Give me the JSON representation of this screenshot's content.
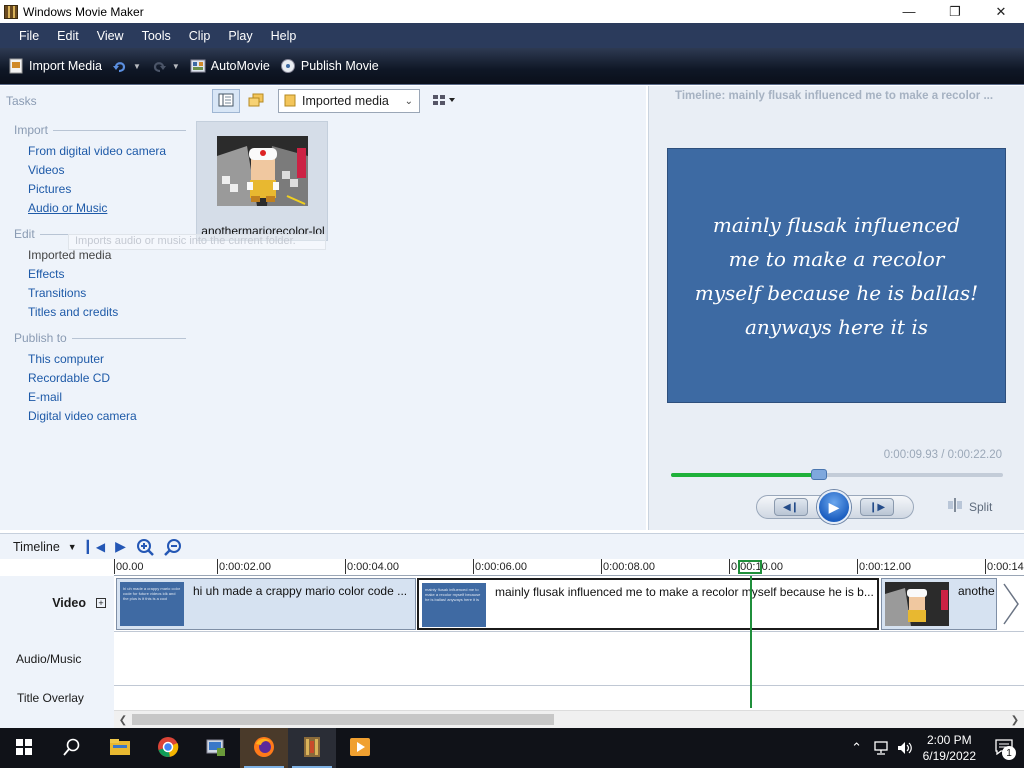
{
  "window": {
    "title": "Windows Movie Maker",
    "controls": [
      "minimize-icon",
      "maximize-icon",
      "close-icon"
    ]
  },
  "menu": [
    "File",
    "Edit",
    "View",
    "Tools",
    "Clip",
    "Play",
    "Help"
  ],
  "toolbar": {
    "import_media": "Import Media",
    "automovie": "AutoMovie",
    "publish_movie": "Publish Movie"
  },
  "tasks": {
    "title": "Tasks",
    "groups": [
      {
        "heading": "Import",
        "items": [
          "From digital video camera",
          "Videos",
          "Pictures",
          "Audio or Music"
        ]
      },
      {
        "heading": "Edit",
        "items": [
          "Imported media",
          "Effects",
          "Transitions",
          "Titles and credits"
        ]
      },
      {
        "heading": "Publish to",
        "items": [
          "This computer",
          "Recordable CD",
          "E-mail",
          "Digital video camera"
        ]
      }
    ]
  },
  "collection": {
    "dropdown": "Imported media",
    "items": [
      {
        "label": "anothermariorecolor-lol"
      }
    ],
    "tooltip": "Imports audio or music into the current folder."
  },
  "preview": {
    "title": "Timeline: mainly flusak influenced me to make a recolor ...",
    "caption_lines": [
      "mainly flusak influenced",
      "me to make a recolor",
      "myself because he is ballas!",
      "anyways here it is"
    ],
    "time": "0:00:09.93 / 0:00:22.20",
    "progress": 0.447,
    "split": "Split"
  },
  "timeline": {
    "label": "Timeline",
    "ruler": [
      "00.00",
      "0:00:02.00",
      "0:00:04.00",
      "0:00:06.00",
      "0:00:08.00",
      "0:00:10.00",
      "0:00:12.00",
      "0:00:14"
    ],
    "tracks": [
      "Video",
      "Audio/Music",
      "Title Overlay"
    ],
    "clips": [
      {
        "text": "hi uh made a crappy mario color code ...",
        "thumb_text": "hi uh made a crappy mario color code for future videos idk and the plus is it this is a cool"
      },
      {
        "text": "mainly flusak influenced me to make a recolor myself because he is b...",
        "thumb_text": "mainly flusak influenced me to make a recolor myself because he is ballas! anyways here it is"
      },
      {
        "text": "anothe",
        "thumb_text": ""
      }
    ]
  },
  "taskbar": {
    "apps": [
      "windows-logo",
      "search",
      "file-explorer",
      "chrome",
      "control-panel",
      "firefox",
      "movie-maker",
      "media-player"
    ],
    "time": "2:00 PM",
    "date": "6/19/2022",
    "notifications": "1"
  }
}
